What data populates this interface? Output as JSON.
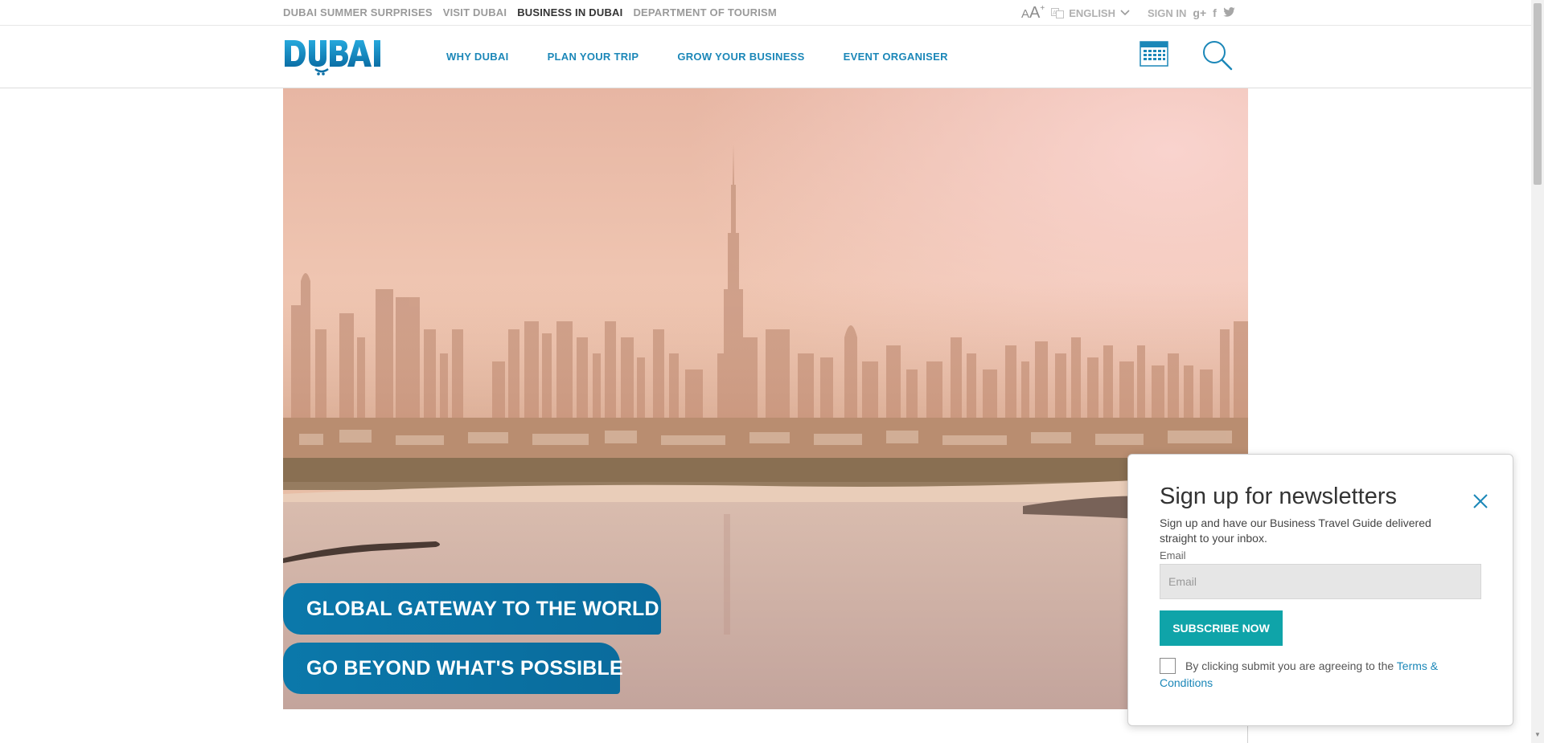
{
  "utility_bar": {
    "links": [
      "DUBAI SUMMER SURPRISES",
      "VISIT DUBAI",
      "BUSINESS IN DUBAI",
      "DEPARTMENT OF TOURISM"
    ],
    "active_index": 2,
    "font_size_small": "A",
    "font_size_big": "A",
    "font_size_plus": "+",
    "language": "ENGLISH",
    "sign_in": "SIGN IN",
    "social": {
      "google_plus": "g+",
      "facebook": "f",
      "twitter": "twitter-icon"
    }
  },
  "header": {
    "logo": "DUBAI",
    "nav": [
      "WHY DUBAI",
      "PLAN YOUR TRIP",
      "GROW YOUR BUSINESS",
      "EVENT ORGANISER"
    ],
    "calendar_icon": "calendar-icon",
    "search_icon": "search-icon"
  },
  "hero": {
    "image": "dubai-skyline-photo",
    "taglines": [
      "GLOBAL GATEWAY TO THE WORLD",
      "GO BEYOND WHAT'S POSSIBLE"
    ]
  },
  "newsletter": {
    "title": "Sign up for newsletters",
    "description": "Sign up and have our Business Travel Guide delivered straight to your inbox.",
    "email_label": "Email",
    "email_placeholder": "Email",
    "subscribe_label": "SUBSCRIBE NOW",
    "terms_text": "By clicking submit you are agreeing to the ",
    "terms_link": "Terms & Conditions"
  },
  "colors": {
    "accent_blue": "#1b87b8",
    "tagline_blue": "#0b78aa",
    "subscribe_teal": "#0fa4a9"
  }
}
